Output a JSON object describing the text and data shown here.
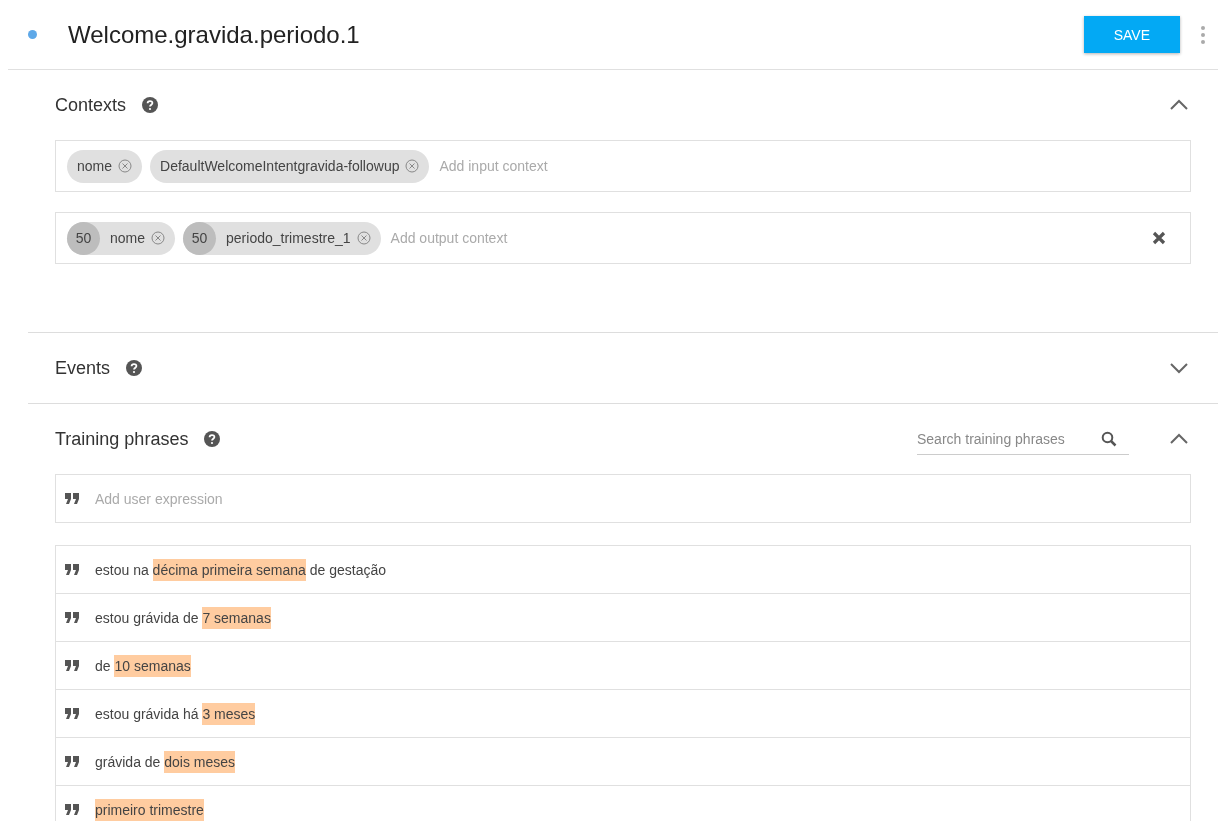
{
  "header": {
    "title": "Welcome.gravida.periodo.1",
    "save_label": "SAVE"
  },
  "contexts": {
    "title": "Contexts",
    "expanded": true,
    "input": {
      "chips": [
        {
          "label": "nome"
        },
        {
          "label": "DefaultWelcomeIntentgravida-followup"
        }
      ],
      "placeholder": "Add input context"
    },
    "output": {
      "chips": [
        {
          "lifespan": "50",
          "label": "nome"
        },
        {
          "lifespan": "50",
          "label": "periodo_trimestre_1"
        }
      ],
      "placeholder": "Add output context"
    }
  },
  "events": {
    "title": "Events",
    "expanded": false
  },
  "training": {
    "title": "Training phrases",
    "expanded": true,
    "search_placeholder": "Search training phrases",
    "add_placeholder": "Add user expression",
    "phrases": [
      [
        {
          "text": "estou na ",
          "highlighted": false
        },
        {
          "text": "décima primeira semana",
          "highlighted": true
        },
        {
          "text": " de gestação",
          "highlighted": false
        }
      ],
      [
        {
          "text": "estou grávida de ",
          "highlighted": false
        },
        {
          "text": "7 semanas",
          "highlighted": true
        }
      ],
      [
        {
          "text": "de ",
          "highlighted": false
        },
        {
          "text": "10 semanas",
          "highlighted": true
        }
      ],
      [
        {
          "text": "estou grávida há ",
          "highlighted": false
        },
        {
          "text": "3 meses",
          "highlighted": true
        }
      ],
      [
        {
          "text": "grávida de ",
          "highlighted": false
        },
        {
          "text": "dois meses",
          "highlighted": true
        }
      ],
      [
        {
          "text": "primeiro trimestre",
          "highlighted": true
        }
      ]
    ]
  }
}
